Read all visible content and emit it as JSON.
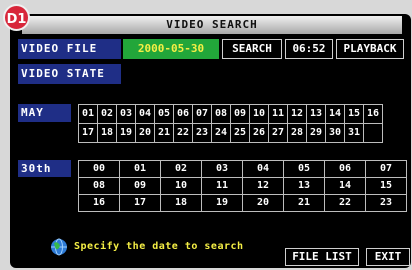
{
  "badge": "D1",
  "title": "VIDEO SEARCH",
  "video_file_label": "VIDEO FILE",
  "date_value": "2000-05-30",
  "search_button": "SEARCH",
  "time_value": "06:52",
  "playback_button": "PLAYBACK",
  "video_state_label": "VIDEO STATE",
  "month_label": "MAY",
  "days": [
    "01",
    "02",
    "03",
    "04",
    "05",
    "06",
    "07",
    "08",
    "09",
    "10",
    "11",
    "12",
    "13",
    "14",
    "15",
    "16",
    "17",
    "18",
    "19",
    "20",
    "21",
    "22",
    "23",
    "24",
    "25",
    "26",
    "27",
    "28",
    "29",
    "30",
    "31"
  ],
  "day_label": "30th",
  "hours": [
    "00",
    "01",
    "02",
    "03",
    "04",
    "05",
    "06",
    "07",
    "08",
    "09",
    "10",
    "11",
    "12",
    "13",
    "14",
    "15",
    "16",
    "17",
    "18",
    "19",
    "20",
    "21",
    "22",
    "23"
  ],
  "hint": "Specify the date to search",
  "file_list_button": "FILE LIST",
  "exit_button": "EXIT",
  "colors": {
    "header_bg": "#1f2e86",
    "date_bg": "#22a63a",
    "accent_text": "#f5ef45"
  }
}
